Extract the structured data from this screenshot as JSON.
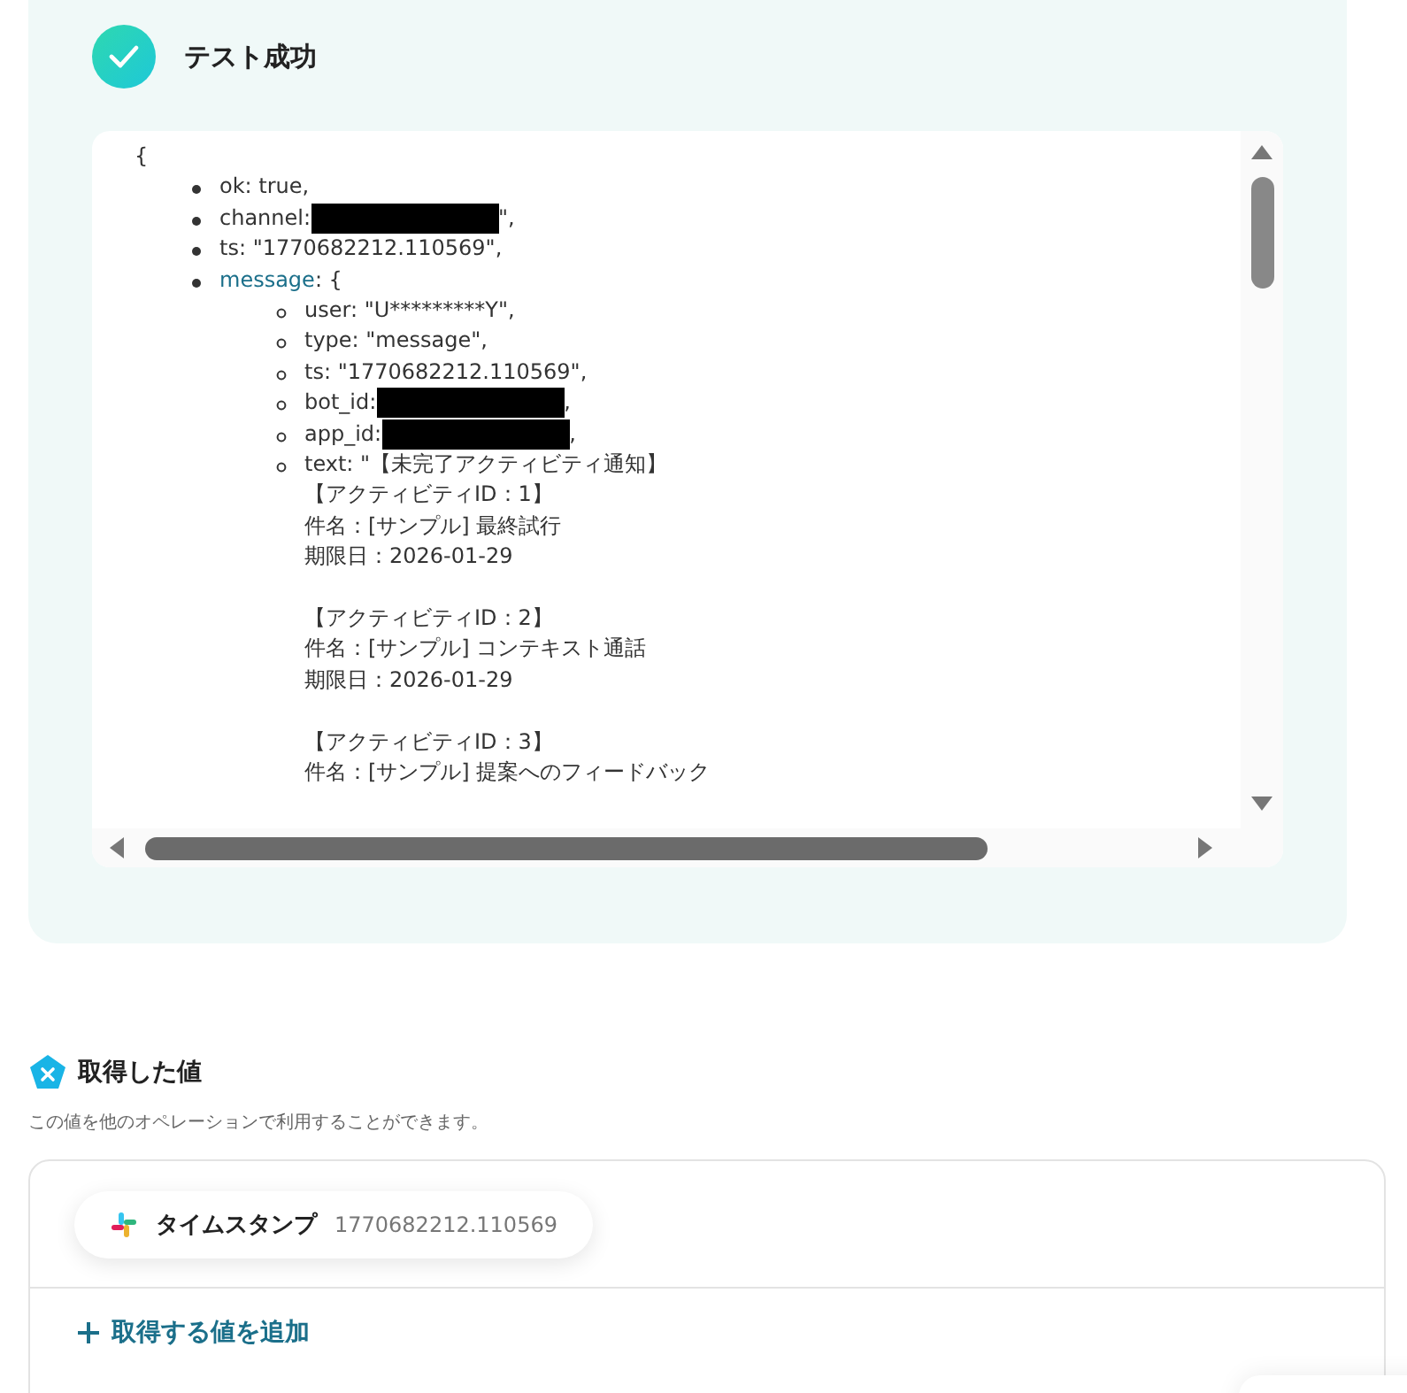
{
  "result": {
    "title": "テスト成功",
    "code": {
      "open": "{",
      "items": [
        {
          "text": "ok: true,"
        },
        {
          "text": "channel:",
          "redacted": true,
          "after": "\","
        },
        {
          "text": "ts: \"1770682212.110569\","
        },
        {
          "link": "message",
          "text": ": {",
          "children": [
            {
              "text": "user: \"U*********Y\","
            },
            {
              "text": "type: \"message\","
            },
            {
              "text": "ts: \"1770682212.110569\","
            },
            {
              "text": "bot_id:",
              "redacted": true,
              "after": ","
            },
            {
              "text": "app_id:",
              "redacted": true,
              "after": ","
            },
            {
              "blocks": [
                [
                  "text: \"【未完了アクティビティ通知】",
                  "【アクティビティID：1】",
                  "件名：[サンプル] 最終試行",
                  "期限日：2026-01-29"
                ],
                [
                  "【アクティビティID：2】",
                  "件名：[サンプル] コンテキスト通話",
                  "期限日：2026-01-29"
                ],
                [
                  "【アクティビティID：3】",
                  "件名：[サンプル] 提案へのフィードバック"
                ]
              ]
            }
          ]
        }
      ]
    }
  },
  "values": {
    "title": "取得した値",
    "description": "この値を他のオペレーションで利用することができます。",
    "chips": [
      {
        "label": "タイムスタンプ",
        "value": "1770682212.110569"
      }
    ],
    "add_button": "取得する値を追加"
  }
}
